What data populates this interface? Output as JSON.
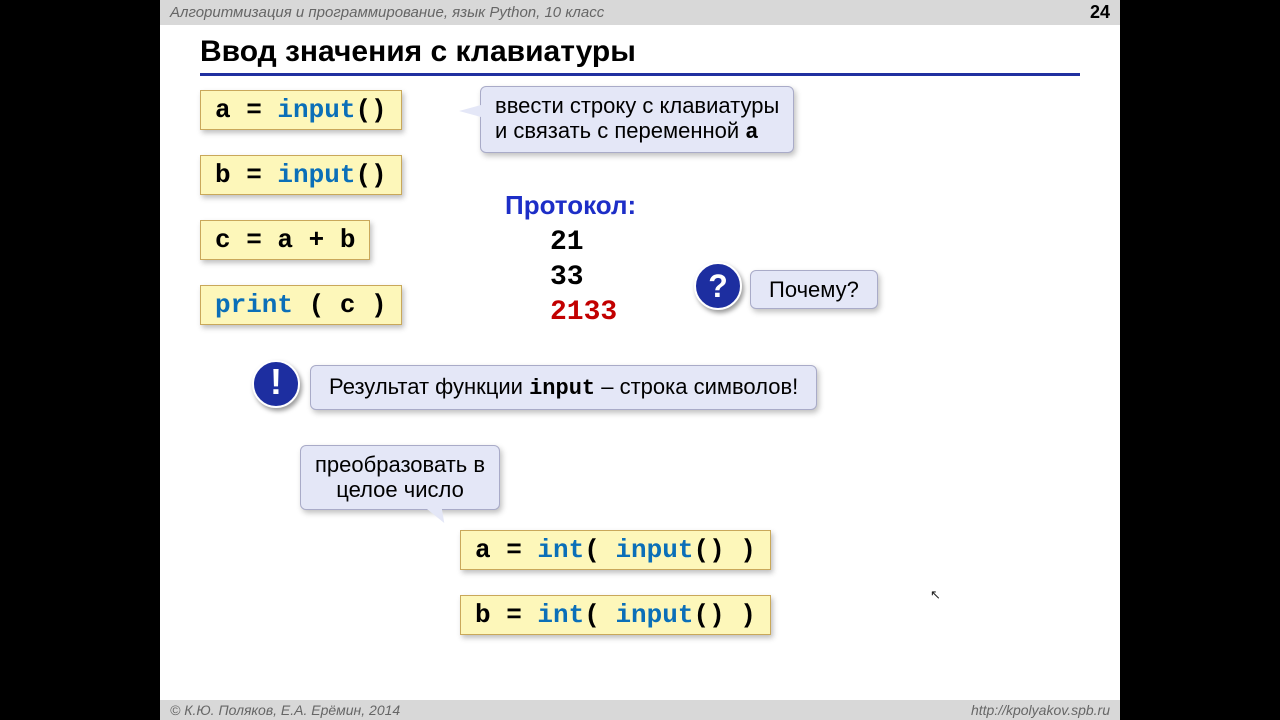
{
  "header": {
    "course": "Алгоритмизация и программирование, язык Python, 10 класс",
    "page": "24"
  },
  "title": "Ввод значения с клавиатуры",
  "code": {
    "l1": {
      "var": "a",
      "eq": " = ",
      "fn": "input",
      "paren": "()"
    },
    "l2": {
      "var": "b",
      "eq": " = ",
      "fn": "input",
      "paren": "()"
    },
    "l3_text": "c = a + b",
    "l4": {
      "fn": "print",
      "open": " ( ",
      "arg": "c",
      "close": " )"
    },
    "l5": {
      "var": "a",
      "eq": " = ",
      "cast": "int",
      "open": "( ",
      "fn": "input",
      "paren": "()",
      "close": " )"
    },
    "l6": {
      "var": "b",
      "eq": " = ",
      "cast": "int",
      "open": "( ",
      "fn": "input",
      "paren": "()",
      "close": " )"
    }
  },
  "callouts": {
    "desc_line1": "ввести строку с клавиатуры",
    "desc_line2_a": "и связать с переменной ",
    "desc_line2_b": "a",
    "why": "Почему?",
    "result_a": "Результат функции ",
    "result_b": "input",
    "result_c": " – строка символов!",
    "convert_a": "преобразовать в",
    "convert_b": "целое число"
  },
  "protocol": {
    "heading": "Протокол:",
    "v1": "21",
    "v2": "33",
    "v3": "2133"
  },
  "badges": {
    "q": "?",
    "ex": "!"
  },
  "footer": {
    "left": "© К.Ю. Поляков, Е.А. Ерёмин, 2014",
    "right": "http://kpolyakov.spb.ru"
  }
}
